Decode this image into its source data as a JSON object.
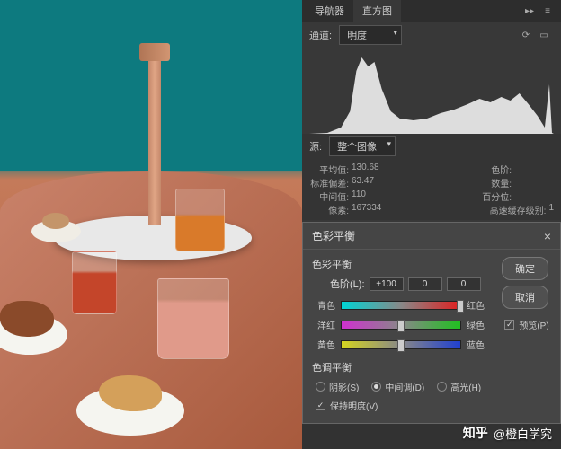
{
  "tabs": {
    "navigator": "导航器",
    "histogram": "直方图"
  },
  "channel": {
    "label": "通道:",
    "value": "明度"
  },
  "source": {
    "label": "源:",
    "value": "整个图像"
  },
  "stats": {
    "mean_label": "平均值:",
    "mean": "130.68",
    "std_label": "标准偏差:",
    "std": "63.47",
    "median_label": "中间值:",
    "median": "110",
    "pixels_label": "像素:",
    "pixels": "167334",
    "level_label": "色阶:",
    "count_label": "数量:",
    "percentile_label": "百分位:",
    "cache_label": "高速缓存级别:",
    "cache": "1"
  },
  "dialog": {
    "title": "色彩平衡",
    "group1": "色彩平衡",
    "levels_label": "色阶(L):",
    "levels": [
      "+100",
      "0",
      "0"
    ],
    "sliders": [
      {
        "left": "青色",
        "right": "红色",
        "pos": 100
      },
      {
        "left": "洋红",
        "right": "绿色",
        "pos": 50
      },
      {
        "left": "黄色",
        "right": "蓝色",
        "pos": 50
      }
    ],
    "group2": "色调平衡",
    "radios": {
      "shadows": "阴影(S)",
      "midtones": "中间调(D)",
      "highlights": "高光(H)"
    },
    "preserve": "保持明度(V)",
    "ok": "确定",
    "cancel": "取消",
    "preview": "预览(P)"
  },
  "watermark": {
    "logo": "知乎",
    "author": "@橙白学究"
  }
}
